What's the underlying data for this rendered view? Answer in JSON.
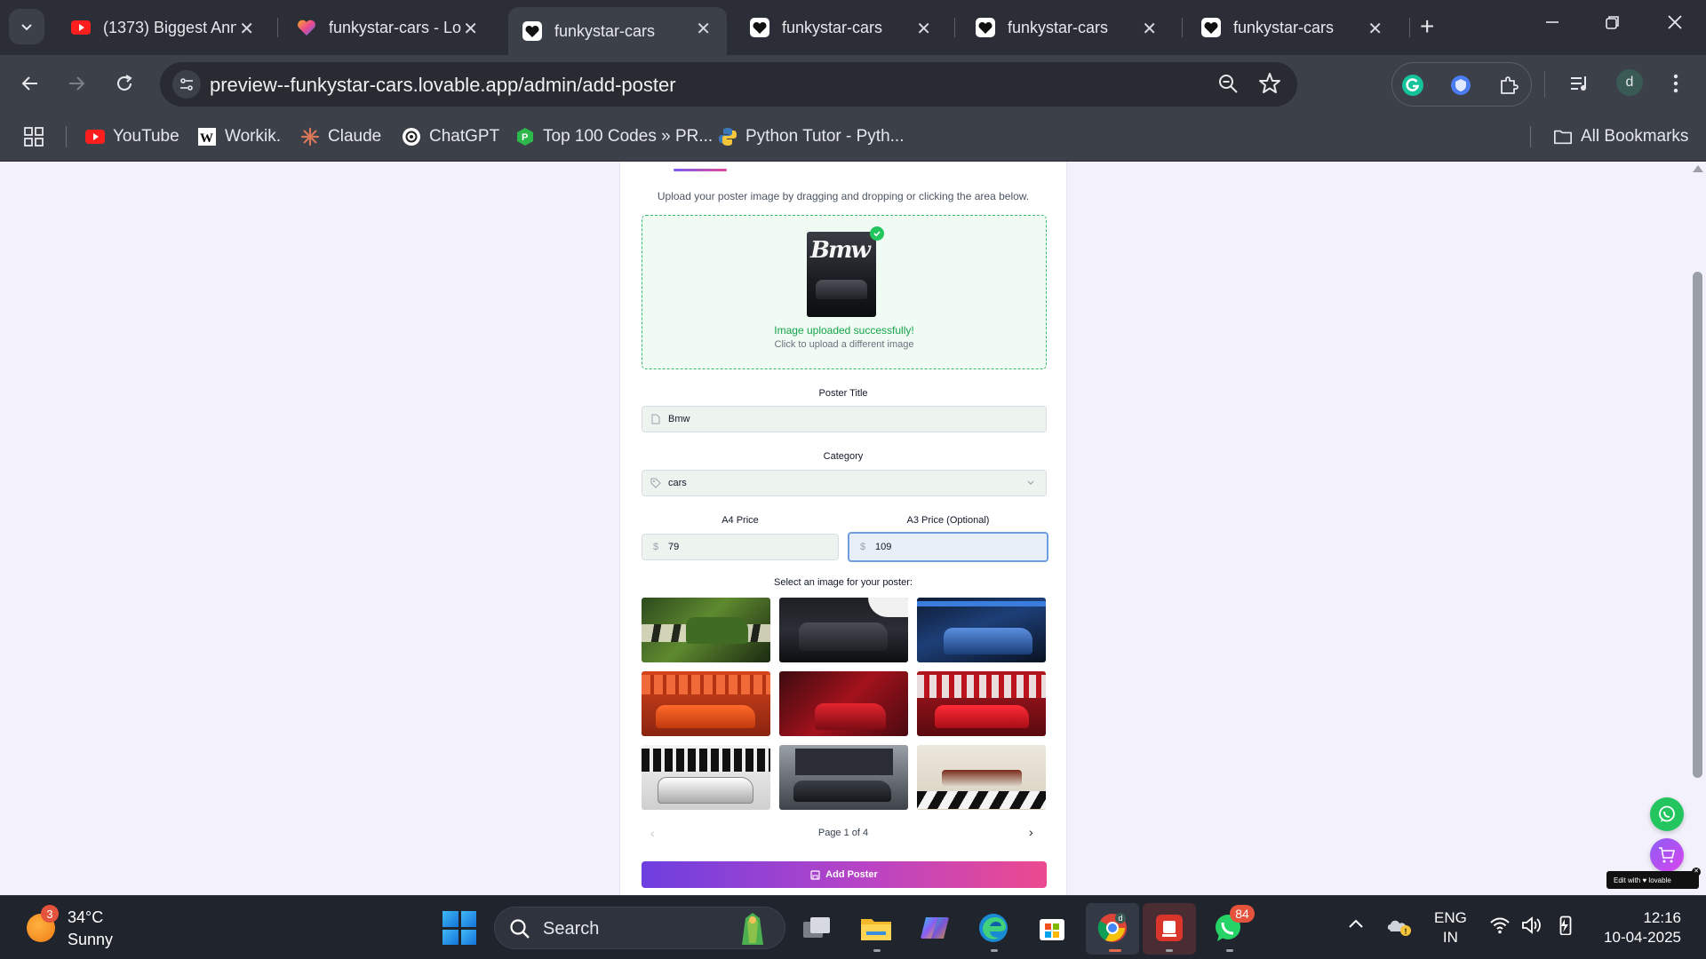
{
  "browser": {
    "tabs": [
      {
        "title": "(1373) Biggest Ann",
        "favicon": "youtube-icon"
      },
      {
        "title": "funkystar-cars - Lo",
        "favicon": "lovable-heart-icon"
      },
      {
        "title": "funkystar-cars",
        "favicon": "heart-icon",
        "active": true
      },
      {
        "title": "funkystar-cars",
        "favicon": "heart-icon"
      },
      {
        "title": "funkystar-cars",
        "favicon": "heart-icon"
      },
      {
        "title": "funkystar-cars",
        "favicon": "heart-icon"
      }
    ],
    "url": "preview--funkystar-cars.lovable.app/admin/add-poster",
    "profile_initial": "d",
    "bookmarks": [
      {
        "label": "YouTube",
        "icon": "youtube-icon"
      },
      {
        "label": "Workik.",
        "icon": "workik-icon"
      },
      {
        "label": "Claude",
        "icon": "claude-icon"
      },
      {
        "label": "ChatGPT",
        "icon": "chatgpt-icon"
      },
      {
        "label": "Top 100 Codes » PR...",
        "icon": "code-icon"
      },
      {
        "label": "Python Tutor - Pyth...",
        "icon": "python-icon"
      }
    ],
    "all_bookmarks": "All Bookmarks"
  },
  "page": {
    "intro": "Upload your poster image by dragging and dropping or clicking the area below.",
    "upload_success": "Image uploaded successfully!",
    "upload_hint": "Click to upload a different image",
    "thumb_text": "Bmw",
    "poster_title_label": "Poster Title",
    "poster_title_value": "Bmw",
    "category_label": "Category",
    "category_value": "cars",
    "a4_label": "A4 Price",
    "a4_value": "79",
    "a3_label": "A3 Price (Optional)",
    "a3_value": "109",
    "currency": "$",
    "grid_title": "Select an image for your poster:",
    "pager": "Page 1 of 4",
    "add_button": "Add Poster",
    "lovable_badge": "Edit with ♥ lovable"
  },
  "taskbar": {
    "weather_badge": "3",
    "temperature": "34°C",
    "condition": "Sunny",
    "search": "Search",
    "whatsapp_badge": "84",
    "lang_top": "ENG",
    "lang_bottom": "IN",
    "time": "12:16",
    "date": "10-04-2025"
  },
  "colors": {
    "accent_start": "#6d3fe0",
    "accent_end": "#ec4a8f",
    "success": "#16a34a"
  }
}
